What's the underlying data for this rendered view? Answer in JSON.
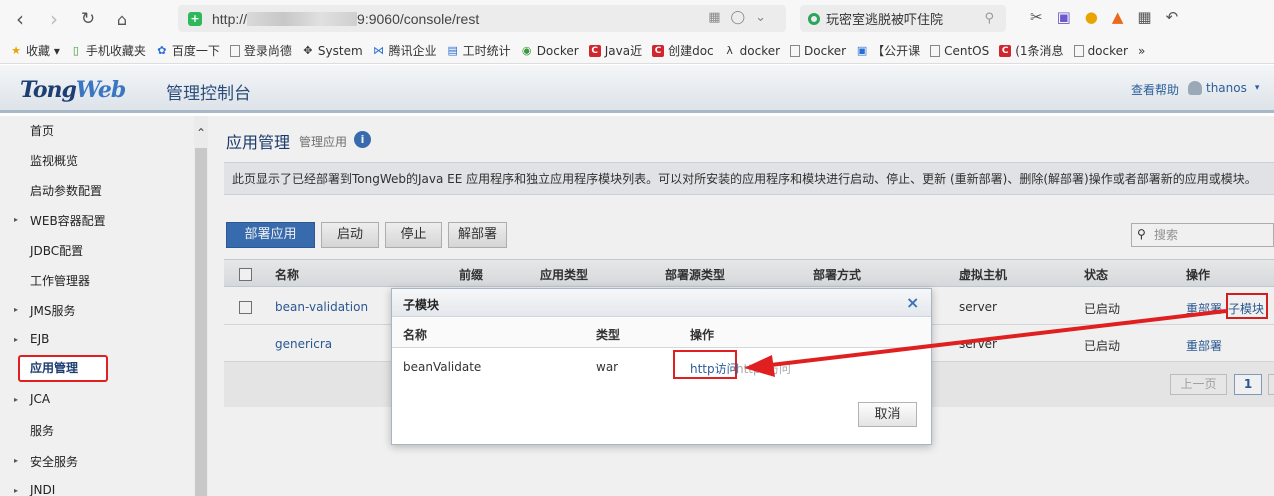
{
  "browser": {
    "url_prefix": "http://",
    "url_suffix": "9:9060/console/rest",
    "search_text": "玩密室逃脱被吓住院",
    "bookmarks": [
      {
        "label": "收藏",
        "icon": "star-icon"
      },
      {
        "label": "手机收藏夹",
        "icon": "phone-icon"
      },
      {
        "label": "百度一下",
        "icon": "paw-icon"
      },
      {
        "label": "登录尚德",
        "icon": "doc-icon"
      },
      {
        "label": "System",
        "icon": "tool-icon"
      },
      {
        "label": "腾讯企业",
        "icon": "mail-icon"
      },
      {
        "label": "工时统计",
        "icon": "table-icon"
      },
      {
        "label": "Docker",
        "icon": "docker-icon"
      },
      {
        "label": "Java近",
        "icon": "csdn-icon"
      },
      {
        "label": "创建doc",
        "icon": "csdn-icon"
      },
      {
        "label": "docker",
        "icon": "link-icon"
      },
      {
        "label": "Docker",
        "icon": "doc-icon"
      },
      {
        "label": "【公开课",
        "icon": "bilibili-icon"
      },
      {
        "label": "CentOS",
        "icon": "doc-icon"
      },
      {
        "label": "(1条消息",
        "icon": "csdn-icon"
      },
      {
        "label": "docker",
        "icon": "doc-icon"
      }
    ],
    "more": "»"
  },
  "header": {
    "logo_a": "Tong",
    "logo_b": "Web",
    "title": "管理控制台",
    "help": "查看帮助",
    "user": "thanos",
    "user_caret": "▾"
  },
  "sidebar": {
    "items": [
      {
        "label": "首页",
        "arrow": false
      },
      {
        "label": "监视概览",
        "arrow": false
      },
      {
        "label": "启动参数配置",
        "arrow": false
      },
      {
        "label": "WEB容器配置",
        "arrow": true
      },
      {
        "label": "JDBC配置",
        "arrow": false
      },
      {
        "label": "工作管理器",
        "arrow": false
      },
      {
        "label": "JMS服务",
        "arrow": true
      },
      {
        "label": "EJB",
        "arrow": true
      },
      {
        "label": "应用管理",
        "arrow": false
      },
      {
        "label": "JCA",
        "arrow": true
      },
      {
        "label": "服务",
        "arrow": false
      },
      {
        "label": "安全服务",
        "arrow": true
      },
      {
        "label": "JNDI",
        "arrow": true
      }
    ]
  },
  "main": {
    "title": "应用管理",
    "subtitle": "管理应用",
    "description": "此页显示了已经部署到TongWeb的Java EE 应用程序和独立应用程序模块列表。可以对所安装的应用程序和模块进行启动、停止、更新 (重新部署)、删除(解部署)操作或者部署新的应用或模块。",
    "buttons": {
      "deploy": "部署应用",
      "start": "启动",
      "stop": "停止",
      "undeploy": "解部署"
    },
    "search_placeholder": "搜索",
    "columns": {
      "name": "名称",
      "prefix": "前缀",
      "app_type": "应用类型",
      "source_type": "部署源类型",
      "deploy_mode": "部署方式",
      "vhost": "虚拟主机",
      "status": "状态",
      "ops": "操作"
    },
    "rows": [
      {
        "name": "bean-validation",
        "vhost": "server",
        "status": "已启动",
        "op1": "重部署",
        "op2": "子模块"
      },
      {
        "name": "genericra",
        "vhost": "server",
        "status": "已启动",
        "op1": "重部署"
      }
    ],
    "pager": {
      "prev": "上一页",
      "current": "1"
    }
  },
  "modal": {
    "title": "子模块",
    "close": "×",
    "columns": {
      "name": "名称",
      "type": "类型",
      "ops": "操作"
    },
    "row": {
      "name": "beanValidate",
      "type": "war",
      "link": "http访问",
      "link2": "https访问"
    },
    "cancel": "取消"
  },
  "colors": {
    "accent": "#3c72b8",
    "highlight": "#e02020"
  }
}
